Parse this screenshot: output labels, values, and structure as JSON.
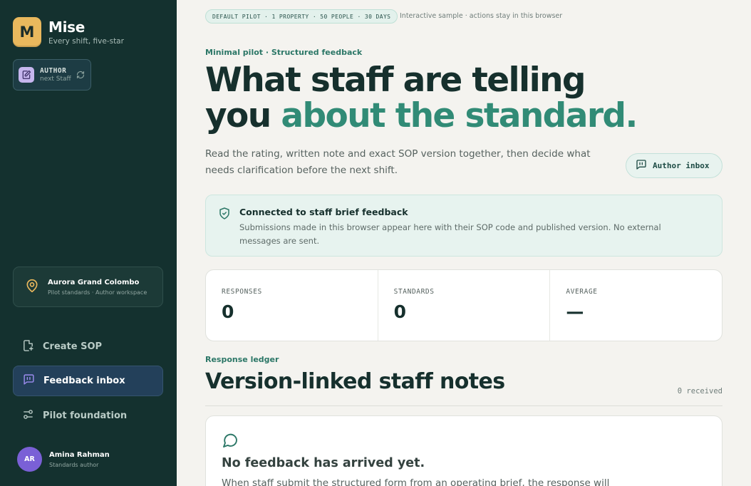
{
  "sidebar": {
    "brand": {
      "logo_letter": "M",
      "name": "Mise",
      "tagline": "Every shift, five-star"
    },
    "role": {
      "title": "AUTHOR",
      "subtitle": "next Staff"
    },
    "property": {
      "name": "Aurora Grand Colombo",
      "subtitle": "Pilot standards · Author workspace"
    },
    "nav": [
      {
        "label": "Create SOP",
        "icon": "file-plus-icon",
        "active": false
      },
      {
        "label": "Feedback inbox",
        "icon": "message-square-icon",
        "active": true
      },
      {
        "label": "Pilot foundation",
        "icon": "sliders-icon",
        "active": false
      }
    ],
    "user": {
      "initials": "AR",
      "name": "Amina Rahman",
      "role": "Standards author"
    }
  },
  "main": {
    "pill": "DEFAULT PILOT · 1 PROPERTY · 50 PEOPLE · 30 DAYS",
    "pill_note": "Interactive sample · actions stay in this browser",
    "eyebrow": "Minimal pilot · Structured feedback",
    "headline_line1": "What staff are telling",
    "headline_line2_plain": "you",
    "headline_line2_accent": "about the standard.",
    "lead": "Read the rating, written note and exact SOP version together, then decide what needs clarification before the next shift.",
    "author_inbox_label": "Author inbox",
    "notice": {
      "title": "Connected to staff brief feedback",
      "body": "Submissions made in this browser appear here with their SOP code and published version. No external messages are sent."
    },
    "stats": [
      {
        "label": "RESPONSES",
        "value": "0"
      },
      {
        "label": "STANDARDS",
        "value": "0"
      },
      {
        "label": "AVERAGE",
        "value": "—"
      }
    ],
    "ledger": {
      "eyebrow": "Response ledger",
      "title": "Version-linked staff notes",
      "count": "0 received"
    },
    "empty": {
      "title": "No feedback has arrived yet.",
      "body": "When staff submit the structured form from an operating brief, the response will"
    }
  },
  "colors": {
    "sidebar_bg": "#14312f",
    "accent": "#318b76",
    "logo": "#e9b85d",
    "avatar": "#7a60d6"
  }
}
